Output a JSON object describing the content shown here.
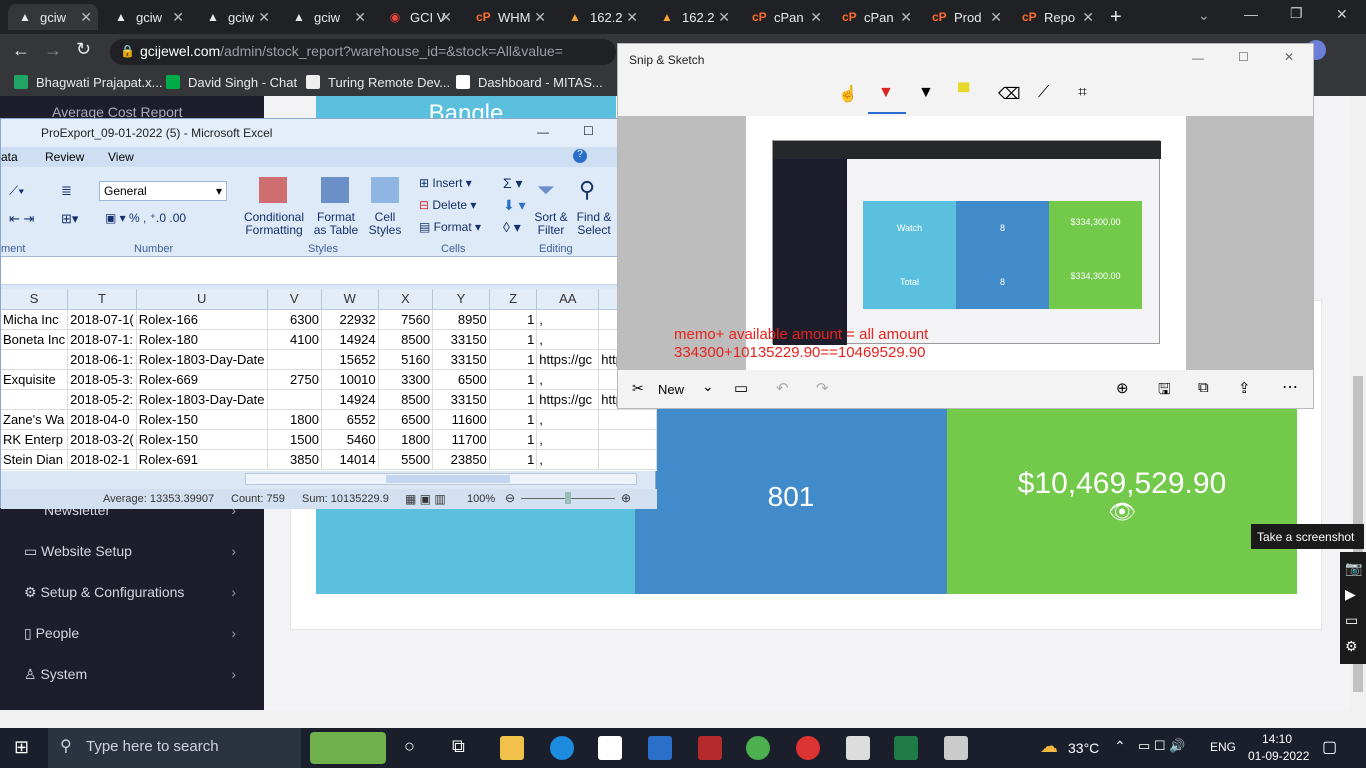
{
  "browser": {
    "tabs": [
      {
        "label": "gciw"
      },
      {
        "label": "gciw"
      },
      {
        "label": "gciw"
      },
      {
        "label": "gciw"
      },
      {
        "label": "GCI V"
      },
      {
        "label": "WHM"
      },
      {
        "label": "162.2"
      },
      {
        "label": "162.2"
      },
      {
        "label": "cPan"
      },
      {
        "label": "cPan"
      },
      {
        "label": "Prod"
      },
      {
        "label": "Repo"
      }
    ],
    "url_host": "gcijewel.com",
    "url_path": "/admin/stock_report?warehouse_id=&stock=All&value=",
    "bookmarks": [
      "Bhagwati Prajapat.x...",
      "David Singh - Chat",
      "Turing Remote Dev...",
      "Dashboard - MITAS..."
    ]
  },
  "page": {
    "sidebar_top_item": "Average Cost Report",
    "category_header": "Bangle",
    "nav": [
      "Newsletter",
      "Website Setup",
      "Setup & Configurations",
      "People",
      "System"
    ],
    "total_count": "801",
    "total_amount": "$10,469,529.90"
  },
  "excel": {
    "title": "ProExport_09-01-2022 (5)  -  Microsoft Excel",
    "menu": [
      "ata",
      "Review",
      "View"
    ],
    "number_format": "General",
    "ribbon": {
      "conditional": "Conditional\nFormatting",
      "format_table": "Format\nas Table",
      "cell_styles": "Cell\nStyles",
      "insert": "Insert",
      "delete": "Delete",
      "format": "Format",
      "sort": "Sort &\nFilter",
      "find": "Find &\nSelect",
      "groups": [
        "ment",
        "Number",
        "Styles",
        "Cells",
        "Editing"
      ]
    },
    "columns": [
      "S",
      "T",
      "U",
      "V",
      "W",
      "X",
      "Y",
      "Z",
      "AA",
      "AB"
    ],
    "rows": [
      [
        "Micha Inc",
        "2018-07-1(",
        "Rolex-166",
        "6300",
        "22932",
        "7560",
        "8950",
        "1",
        ",",
        ""
      ],
      [
        "Boneta Inc",
        "2018-07-1:",
        "Rolex-180",
        "4100",
        "14924",
        "8500",
        "33150",
        "1",
        ",",
        ""
      ],
      [
        "",
        "2018-06-1:",
        "Rolex-1803-Day-Date",
        "",
        "15652",
        "5160",
        "33150",
        "1",
        "https://gc",
        "https://"
      ],
      [
        "Exquisite",
        "2018-05-3:",
        "Rolex-669",
        "2750",
        "10010",
        "3300",
        "6500",
        "1",
        ",",
        ""
      ],
      [
        "",
        "2018-05-2:",
        "Rolex-1803-Day-Date",
        "",
        "14924",
        "8500",
        "33150",
        "1",
        "https://gc",
        "https://"
      ],
      [
        "Zane's Wa",
        "2018-04-0",
        "Rolex-150",
        "1800",
        "6552",
        "6500",
        "11600",
        "1",
        ",",
        ""
      ],
      [
        "RK Enterp",
        "2018-03-2(",
        "Rolex-150",
        "1500",
        "5460",
        "1800",
        "11700",
        "1",
        ",",
        ""
      ],
      [
        "Stein Dian",
        "2018-02-1",
        "Rolex-691",
        "3850",
        "14014",
        "5500",
        "23850",
        "1",
        ",",
        ""
      ]
    ],
    "status": {
      "average": "Average: 13353.39907",
      "count": "Count: 759",
      "sum": "Sum: 10135229.9",
      "zoom": "100%"
    }
  },
  "snip": {
    "title": "Snip & Sketch",
    "annotation_line1": "memo+ available amount = all amount",
    "annotation_line2": "334300+10135229.90==10469529.90",
    "thumb": {
      "cat1": "Watch",
      "qty1": "8",
      "amt1": "$334,300.00",
      "cat2": "Total",
      "qty2": "8",
      "amt2": "$334,300.00"
    },
    "new_label": "New"
  },
  "tooltip": "Take a screenshot",
  "taskbar": {
    "search_placeholder": "Type here to search",
    "temperature": "33°C",
    "language": "ENG",
    "time": "14:10",
    "date": "01-09-2022"
  }
}
